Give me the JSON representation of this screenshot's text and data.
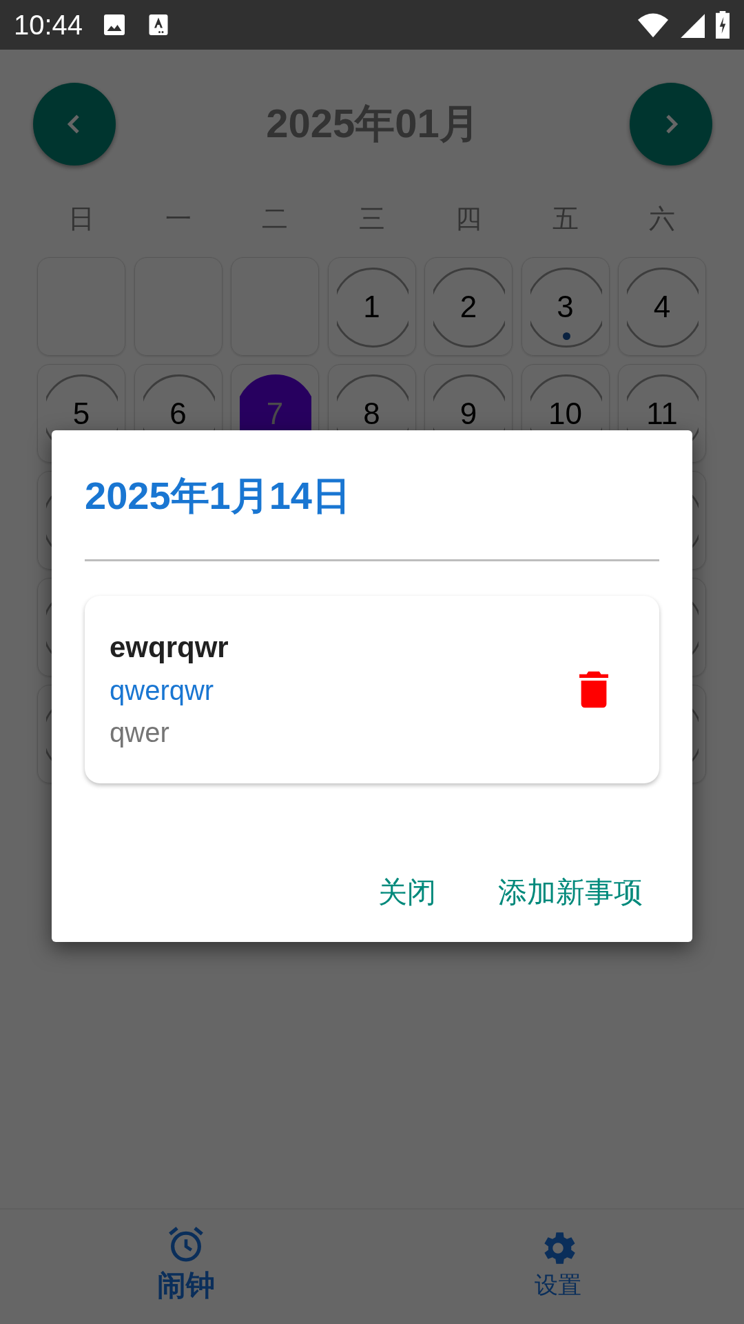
{
  "status_bar": {
    "time": "10:44"
  },
  "header": {
    "title": "2025年01月"
  },
  "weekdays": [
    "日",
    "一",
    "二",
    "三",
    "四",
    "五",
    "六"
  ],
  "cells": [
    {
      "kind": "blank"
    },
    {
      "kind": "blank"
    },
    {
      "kind": "blank"
    },
    {
      "kind": "day",
      "label": "1",
      "event": false,
      "selected": false
    },
    {
      "kind": "day",
      "label": "2",
      "event": false,
      "selected": false
    },
    {
      "kind": "day",
      "label": "3",
      "event": true,
      "selected": false
    },
    {
      "kind": "day",
      "label": "4",
      "event": false,
      "selected": false
    },
    {
      "kind": "day",
      "label": "5",
      "event": false,
      "selected": false
    },
    {
      "kind": "day",
      "label": "6",
      "event": false,
      "selected": false
    },
    {
      "kind": "day",
      "label": "7",
      "event": false,
      "selected": true
    },
    {
      "kind": "day",
      "label": "8",
      "event": false,
      "selected": false
    },
    {
      "kind": "day",
      "label": "9",
      "event": false,
      "selected": false
    },
    {
      "kind": "day",
      "label": "10",
      "event": false,
      "selected": false
    },
    {
      "kind": "day",
      "label": "11",
      "event": false,
      "selected": false
    },
    {
      "kind": "covered"
    },
    {
      "kind": "covered"
    },
    {
      "kind": "covered"
    },
    {
      "kind": "covered"
    },
    {
      "kind": "covered"
    },
    {
      "kind": "covered"
    }
  ],
  "dialog": {
    "title": "2025年1月14日",
    "entries": [
      {
        "title": "ewqrqwr",
        "subtitle": "qwerqwr",
        "note": "qwer"
      }
    ],
    "buttons": [
      "关闭",
      "添加新事项"
    ]
  },
  "nav": [
    {
      "kind": "alarm",
      "label": "闹钟",
      "selected": true
    },
    {
      "kind": "settings",
      "label": "设置",
      "selected": false
    }
  ]
}
